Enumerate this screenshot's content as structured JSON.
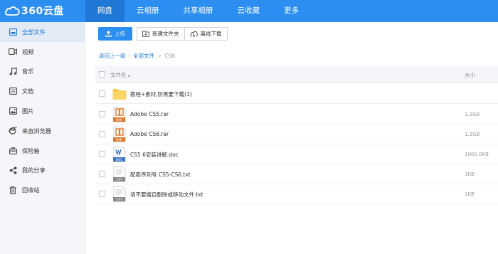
{
  "app": {
    "logo_text": "360云盘"
  },
  "nav": {
    "items": [
      "网盘",
      "云相册",
      "共享相册",
      "云收藏",
      "更多"
    ],
    "active": 0
  },
  "sidebar": {
    "items": [
      {
        "label": "全部文件",
        "icon": "folder-icon"
      },
      {
        "label": "视频",
        "icon": "video-icon"
      },
      {
        "label": "音乐",
        "icon": "music-icon"
      },
      {
        "label": "文档",
        "icon": "document-icon"
      },
      {
        "label": "图片",
        "icon": "image-icon"
      },
      {
        "label": "来自浏览器",
        "icon": "browser-icon"
      },
      {
        "label": "保险箱",
        "icon": "safe-icon"
      },
      {
        "label": "我的分享",
        "icon": "share-icon"
      },
      {
        "label": "回收站",
        "icon": "trash-icon"
      }
    ],
    "active": 0
  },
  "toolbar": {
    "upload_label": "上传",
    "new_folder_label": "新建文件夹",
    "offline_download_label": "离线下载"
  },
  "breadcrumb": {
    "back_label": "返回上一级",
    "separator": "|",
    "root_label": "全部文件",
    "arrow": ">",
    "current": "CS6"
  },
  "table": {
    "header": {
      "name_label": "文件名",
      "sort_glyph": "▴",
      "size_label": "大小"
    },
    "rows": [
      {
        "name": "教程+素材,防黑要下载(1)",
        "size": "",
        "type": "folder"
      },
      {
        "name": "Adobe CS5.rar",
        "size": "1.3GB",
        "type": "rar",
        "badge": "RAR"
      },
      {
        "name": "Adobe CS6.rar",
        "size": "1.3GB",
        "type": "rar",
        "badge": "RAR"
      },
      {
        "name": "CS5 6安装讲解.doc",
        "size": "1000.0KB",
        "type": "doc",
        "badge": "DOC"
      },
      {
        "name": "配套序列号 CS5-CS6.txt",
        "size": "1KB",
        "type": "txt",
        "badge": "TXT"
      },
      {
        "name": "请不要擅自删除或移动文件.txt",
        "size": "1KB",
        "type": "txt",
        "badge": "TXT"
      }
    ]
  },
  "colors": {
    "brand": "#2b8ef0",
    "brand_dark": "#1f77d6",
    "folder": "#f8c848",
    "rar": "#e0782a",
    "doc": "#3b74c5",
    "txt": "#8a8a8a"
  }
}
